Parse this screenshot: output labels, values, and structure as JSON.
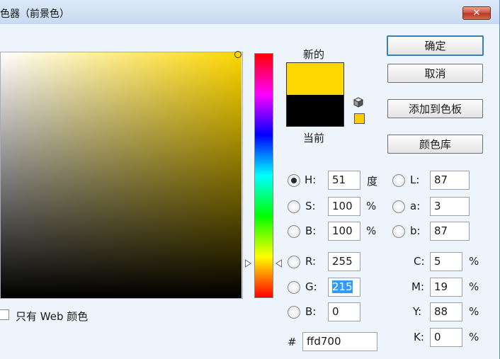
{
  "dialog": {
    "title": "色器（前景色）",
    "close_icon": "close-icon"
  },
  "preview": {
    "new_label": "新的",
    "current_label": "当前",
    "new_color": "#ffd700",
    "current_color": "#000000",
    "websafe_icon": "cube-icon",
    "websafe_color": "#ffcc00"
  },
  "buttons": {
    "ok": "确定",
    "cancel": "取消",
    "add_to_swatches": "添加到色板",
    "color_libraries": "颜色库"
  },
  "hsb": {
    "h": {
      "label": "H:",
      "value": "51",
      "unit": "度",
      "selected": true
    },
    "s": {
      "label": "S:",
      "value": "100",
      "unit": "%",
      "selected": false
    },
    "b": {
      "label": "B:",
      "value": "100",
      "unit": "%",
      "selected": false
    }
  },
  "rgb": {
    "r": {
      "label": "R:",
      "value": "255",
      "selected": false
    },
    "g": {
      "label": "G:",
      "value": "215",
      "selected": false
    },
    "b": {
      "label": "B:",
      "value": "0",
      "selected": false
    }
  },
  "lab": {
    "l": {
      "label": "L:",
      "value": "87",
      "selected": false
    },
    "a": {
      "label": "a:",
      "value": "3",
      "selected": false
    },
    "b": {
      "label": "b:",
      "value": "87",
      "selected": false
    }
  },
  "cmyk": {
    "c": {
      "label": "C:",
      "value": "5",
      "unit": "%"
    },
    "m": {
      "label": "M:",
      "value": "19",
      "unit": "%"
    },
    "y": {
      "label": "Y:",
      "value": "88",
      "unit": "%"
    },
    "k": {
      "label": "K:",
      "value": "0",
      "unit": "%"
    }
  },
  "hex": {
    "label": "#",
    "value": "ffd700"
  },
  "web_only": {
    "label": "只有 Web 颜色",
    "checked": false
  }
}
